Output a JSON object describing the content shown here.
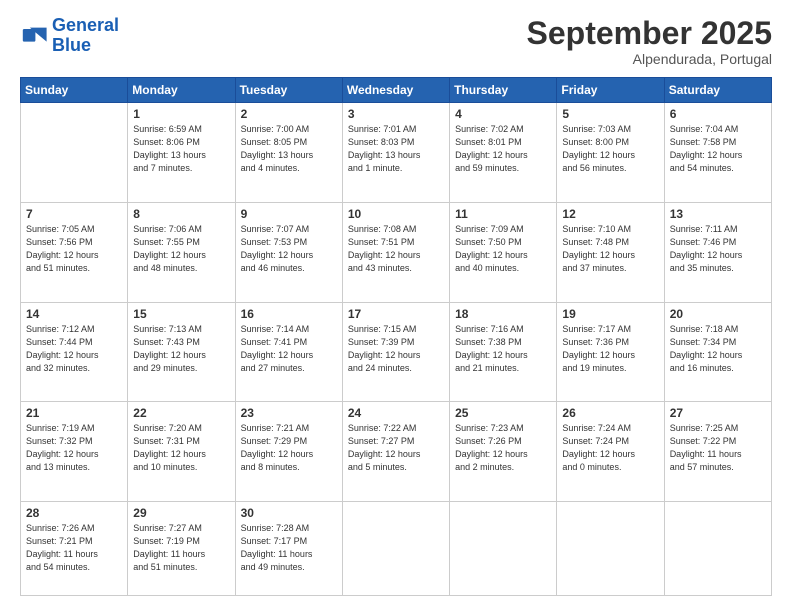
{
  "logo": {
    "line1": "General",
    "line2": "Blue"
  },
  "header": {
    "month_year": "September 2025",
    "location": "Alpendurada, Portugal"
  },
  "days_of_week": [
    "Sunday",
    "Monday",
    "Tuesday",
    "Wednesday",
    "Thursday",
    "Friday",
    "Saturday"
  ],
  "weeks": [
    [
      {
        "day": "",
        "info": ""
      },
      {
        "day": "1",
        "info": "Sunrise: 6:59 AM\nSunset: 8:06 PM\nDaylight: 13 hours\nand 7 minutes."
      },
      {
        "day": "2",
        "info": "Sunrise: 7:00 AM\nSunset: 8:05 PM\nDaylight: 13 hours\nand 4 minutes."
      },
      {
        "day": "3",
        "info": "Sunrise: 7:01 AM\nSunset: 8:03 PM\nDaylight: 13 hours\nand 1 minute."
      },
      {
        "day": "4",
        "info": "Sunrise: 7:02 AM\nSunset: 8:01 PM\nDaylight: 12 hours\nand 59 minutes."
      },
      {
        "day": "5",
        "info": "Sunrise: 7:03 AM\nSunset: 8:00 PM\nDaylight: 12 hours\nand 56 minutes."
      },
      {
        "day": "6",
        "info": "Sunrise: 7:04 AM\nSunset: 7:58 PM\nDaylight: 12 hours\nand 54 minutes."
      }
    ],
    [
      {
        "day": "7",
        "info": "Sunrise: 7:05 AM\nSunset: 7:56 PM\nDaylight: 12 hours\nand 51 minutes."
      },
      {
        "day": "8",
        "info": "Sunrise: 7:06 AM\nSunset: 7:55 PM\nDaylight: 12 hours\nand 48 minutes."
      },
      {
        "day": "9",
        "info": "Sunrise: 7:07 AM\nSunset: 7:53 PM\nDaylight: 12 hours\nand 46 minutes."
      },
      {
        "day": "10",
        "info": "Sunrise: 7:08 AM\nSunset: 7:51 PM\nDaylight: 12 hours\nand 43 minutes."
      },
      {
        "day": "11",
        "info": "Sunrise: 7:09 AM\nSunset: 7:50 PM\nDaylight: 12 hours\nand 40 minutes."
      },
      {
        "day": "12",
        "info": "Sunrise: 7:10 AM\nSunset: 7:48 PM\nDaylight: 12 hours\nand 37 minutes."
      },
      {
        "day": "13",
        "info": "Sunrise: 7:11 AM\nSunset: 7:46 PM\nDaylight: 12 hours\nand 35 minutes."
      }
    ],
    [
      {
        "day": "14",
        "info": "Sunrise: 7:12 AM\nSunset: 7:44 PM\nDaylight: 12 hours\nand 32 minutes."
      },
      {
        "day": "15",
        "info": "Sunrise: 7:13 AM\nSunset: 7:43 PM\nDaylight: 12 hours\nand 29 minutes."
      },
      {
        "day": "16",
        "info": "Sunrise: 7:14 AM\nSunset: 7:41 PM\nDaylight: 12 hours\nand 27 minutes."
      },
      {
        "day": "17",
        "info": "Sunrise: 7:15 AM\nSunset: 7:39 PM\nDaylight: 12 hours\nand 24 minutes."
      },
      {
        "day": "18",
        "info": "Sunrise: 7:16 AM\nSunset: 7:38 PM\nDaylight: 12 hours\nand 21 minutes."
      },
      {
        "day": "19",
        "info": "Sunrise: 7:17 AM\nSunset: 7:36 PM\nDaylight: 12 hours\nand 19 minutes."
      },
      {
        "day": "20",
        "info": "Sunrise: 7:18 AM\nSunset: 7:34 PM\nDaylight: 12 hours\nand 16 minutes."
      }
    ],
    [
      {
        "day": "21",
        "info": "Sunrise: 7:19 AM\nSunset: 7:32 PM\nDaylight: 12 hours\nand 13 minutes."
      },
      {
        "day": "22",
        "info": "Sunrise: 7:20 AM\nSunset: 7:31 PM\nDaylight: 12 hours\nand 10 minutes."
      },
      {
        "day": "23",
        "info": "Sunrise: 7:21 AM\nSunset: 7:29 PM\nDaylight: 12 hours\nand 8 minutes."
      },
      {
        "day": "24",
        "info": "Sunrise: 7:22 AM\nSunset: 7:27 PM\nDaylight: 12 hours\nand 5 minutes."
      },
      {
        "day": "25",
        "info": "Sunrise: 7:23 AM\nSunset: 7:26 PM\nDaylight: 12 hours\nand 2 minutes."
      },
      {
        "day": "26",
        "info": "Sunrise: 7:24 AM\nSunset: 7:24 PM\nDaylight: 12 hours\nand 0 minutes."
      },
      {
        "day": "27",
        "info": "Sunrise: 7:25 AM\nSunset: 7:22 PM\nDaylight: 11 hours\nand 57 minutes."
      }
    ],
    [
      {
        "day": "28",
        "info": "Sunrise: 7:26 AM\nSunset: 7:21 PM\nDaylight: 11 hours\nand 54 minutes."
      },
      {
        "day": "29",
        "info": "Sunrise: 7:27 AM\nSunset: 7:19 PM\nDaylight: 11 hours\nand 51 minutes."
      },
      {
        "day": "30",
        "info": "Sunrise: 7:28 AM\nSunset: 7:17 PM\nDaylight: 11 hours\nand 49 minutes."
      },
      {
        "day": "",
        "info": ""
      },
      {
        "day": "",
        "info": ""
      },
      {
        "day": "",
        "info": ""
      },
      {
        "day": "",
        "info": ""
      }
    ]
  ]
}
